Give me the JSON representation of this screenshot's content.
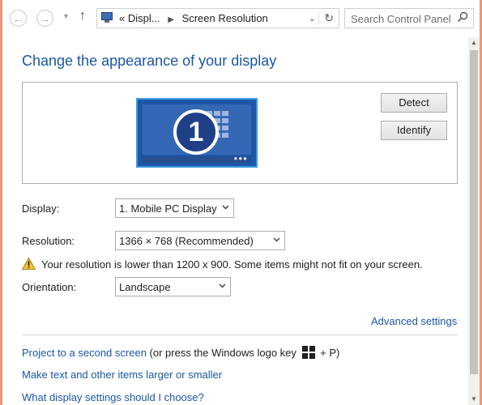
{
  "nav": {
    "back_icon": "back-arrow-icon",
    "forward_icon": "forward-arrow-icon",
    "up_icon": "up-arrow-icon",
    "address": {
      "overflow": "«",
      "crumb1": "Displ...",
      "crumb2": "Screen Resolution"
    },
    "search_placeholder": "Search Control Panel"
  },
  "main": {
    "title": "Change the appearance of your display",
    "monitor_number": "1",
    "detect_label": "Detect",
    "identify_label": "Identify",
    "display": {
      "label": "Display:",
      "value": "1. Mobile PC Display"
    },
    "resolution": {
      "label": "Resolution:",
      "value": "1366 × 768 (Recommended)"
    },
    "warning": "Your resolution is lower than 1200 x 900. Some items might not fit on your screen.",
    "orientation": {
      "label": "Orientation:",
      "value": "Landscape"
    },
    "advanced_settings": "Advanced settings",
    "project_link": "Project to a second screen",
    "project_suffix_pre": " (or press the Windows logo key ",
    "project_suffix_post": " + P)",
    "text_size_link": "Make text and other items larger or smaller",
    "help_link": "What display settings should I choose?"
  },
  "colors": {
    "accent_link": "#1b56a3",
    "window_frame": "#e8987c",
    "monitor_blue": "#1e56a8"
  }
}
